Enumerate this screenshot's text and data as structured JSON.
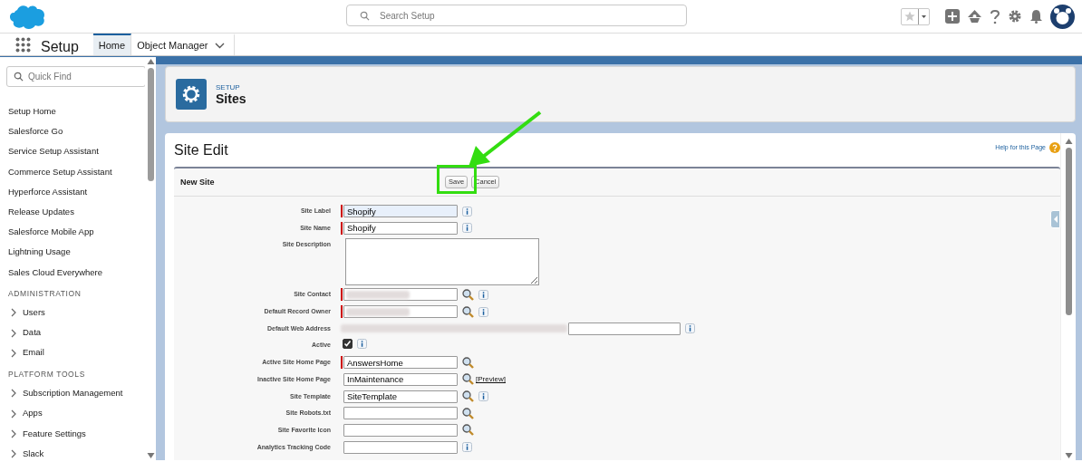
{
  "header": {
    "search": {
      "placeholder": "Search Setup"
    }
  },
  "nav": {
    "app_name": "Setup",
    "tabs": [
      {
        "label": "Home",
        "selected": true,
        "menu": false
      },
      {
        "label": "Object Manager",
        "selected": false,
        "menu": true
      }
    ]
  },
  "sidebar": {
    "quick_find": {
      "placeholder": "Quick Find"
    },
    "items": [
      {
        "kind": "link",
        "label": "Setup Home"
      },
      {
        "kind": "link",
        "label": "Salesforce Go"
      },
      {
        "kind": "link",
        "label": "Service Setup Assistant"
      },
      {
        "kind": "link",
        "label": "Commerce Setup Assistant"
      },
      {
        "kind": "link",
        "label": "Hyperforce Assistant"
      },
      {
        "kind": "link",
        "label": "Release Updates"
      },
      {
        "kind": "link",
        "label": "Salesforce Mobile App"
      },
      {
        "kind": "link",
        "label": "Lightning Usage"
      },
      {
        "kind": "link",
        "label": "Sales Cloud Everywhere"
      },
      {
        "kind": "heading",
        "label": "ADMINISTRATION"
      },
      {
        "kind": "group",
        "label": "Users",
        "expanded": false
      },
      {
        "kind": "group",
        "label": "Data",
        "expanded": false
      },
      {
        "kind": "group",
        "label": "Email",
        "expanded": false
      },
      {
        "kind": "heading",
        "label": "PLATFORM TOOLS"
      },
      {
        "kind": "group",
        "label": "Subscription Management",
        "expanded": false
      },
      {
        "kind": "group",
        "label": "Apps",
        "expanded": false
      },
      {
        "kind": "group",
        "label": "Feature Settings",
        "expanded": false
      },
      {
        "kind": "group",
        "label": "Slack",
        "expanded": false
      }
    ]
  },
  "page_header": {
    "eyebrow": "SETUP",
    "title": "Sites"
  },
  "edit_panel": {
    "title": "Site Edit",
    "help_link": "Help for this Page",
    "section_title": "New Site",
    "buttons": [
      "Save",
      "Cancel"
    ],
    "fields": [
      {
        "kind": "text",
        "label": "Site Label",
        "value": "Shopify",
        "required": true,
        "focused": true,
        "info": true
      },
      {
        "kind": "text",
        "label": "Site Name",
        "value": "Shopify",
        "required": true,
        "focused": false,
        "info": true
      },
      {
        "kind": "textarea",
        "label": "Site Description",
        "required": false,
        "info": false
      },
      {
        "kind": "lookup",
        "label": "Site Contact",
        "required": true,
        "redacted": true,
        "info": true
      },
      {
        "kind": "lookup",
        "label": "Default Record Owner",
        "required": true,
        "redacted": true,
        "info": true
      },
      {
        "kind": "url",
        "label": "Default Web Address",
        "redacted": true,
        "info": true
      },
      {
        "kind": "checkbox",
        "label": "Active",
        "checked": true,
        "info": true
      },
      {
        "kind": "lookup",
        "label": "Active Site Home Page",
        "value": "AnswersHome",
        "required": true,
        "info": false
      },
      {
        "kind": "lookup",
        "label": "Inactive Site Home Page",
        "value": "InMaintenance",
        "required": false,
        "info": false,
        "link": "[Preview]"
      },
      {
        "kind": "lookup",
        "label": "Site Template",
        "value": "SiteTemplate",
        "required": false,
        "info": true
      },
      {
        "kind": "lookup",
        "label": "Site Robots.txt",
        "required": false,
        "info": false
      },
      {
        "kind": "lookup",
        "label": "Site Favorite Icon",
        "required": false,
        "info": false
      },
      {
        "kind": "text",
        "label": "Analytics Tracking Code",
        "required": false,
        "focused": false,
        "info": true
      }
    ]
  }
}
